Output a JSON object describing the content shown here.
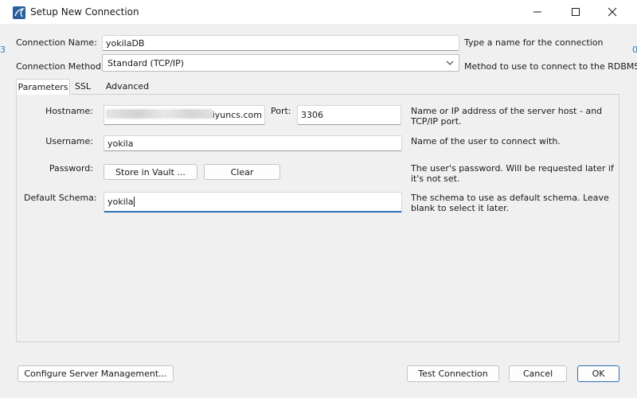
{
  "window": {
    "title": "Setup New Connection"
  },
  "background": {
    "left_peek": "3",
    "right_peek": "0"
  },
  "top": {
    "connection_name_label": "Connection Name:",
    "connection_name_value": "yokilaDB",
    "connection_name_desc": "Type a name for the connection",
    "connection_method_label": "Connection Method:",
    "connection_method_value": "Standard (TCP/IP)",
    "connection_method_desc": "Method to use to connect to the RDBMS"
  },
  "tabs": [
    {
      "label": "Parameters",
      "active": true
    },
    {
      "label": "SSL",
      "active": false
    },
    {
      "label": "Advanced",
      "active": false
    }
  ],
  "params": {
    "hostname_label": "Hostname:",
    "hostname_value": "aliyuncs.com",
    "port_label": "Port:",
    "port_value": "3306",
    "hostname_desc": "Name or IP address of the server host - and TCP/IP port.",
    "username_label": "Username:",
    "username_value": "yokila",
    "username_desc": "Name of the user to connect with.",
    "password_label": "Password:",
    "store_vault_label": "Store in Vault ...",
    "clear_label": "Clear",
    "password_desc": "The user's password. Will be requested later if it's not set.",
    "schema_label": "Default Schema:",
    "schema_value": "yokila",
    "schema_desc": "The schema to use as default schema. Leave blank to select it later."
  },
  "footer": {
    "configure_label": "Configure Server Management...",
    "test_label": "Test Connection",
    "cancel_label": "Cancel",
    "ok_label": "OK"
  },
  "colors": {
    "accent": "#2f6fb3",
    "window_bg": "#f0f0f0",
    "titlebar_bg": "#ffffff"
  },
  "icons": {
    "app": "mysql-workbench-icon",
    "minimize": "minimize-icon",
    "maximize": "maximize-icon",
    "close": "close-icon",
    "dropdown": "chevron-down-icon"
  }
}
